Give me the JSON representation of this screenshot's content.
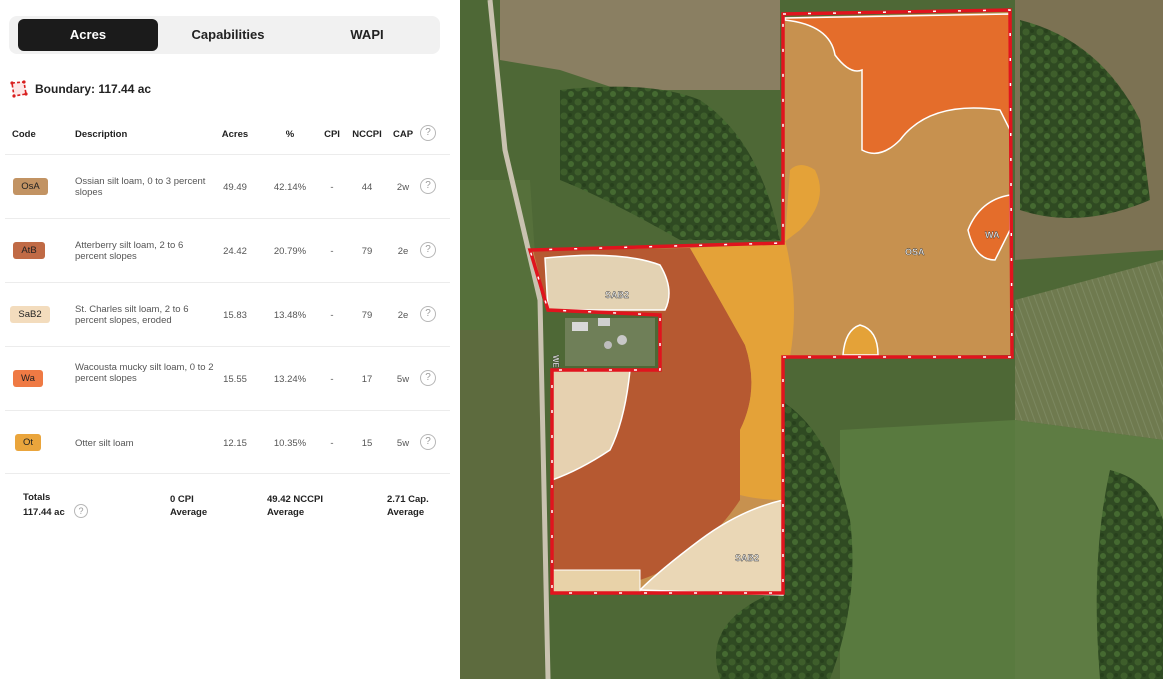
{
  "tabs": [
    {
      "label": "Acres",
      "active": true
    },
    {
      "label": "Capabilities",
      "active": false
    },
    {
      "label": "WAPI",
      "active": false
    }
  ],
  "boundary": {
    "label": "Boundary: 117.44 ac",
    "icon": "boundary-polygon-icon"
  },
  "table": {
    "headers": {
      "code": "Code",
      "description": "Description",
      "acres": "Acres",
      "percent": "%",
      "cpi": "CPI",
      "nccpi": "NCCPI",
      "cap": "CAP"
    },
    "rows": [
      {
        "code": "OsA",
        "color": "#c29363",
        "description": "Ossian silt loam, 0 to 3 percent slopes",
        "acres": "49.49",
        "percent": "42.14%",
        "cpi": "-",
        "nccpi": "44",
        "cap": "2w"
      },
      {
        "code": "AtB",
        "color": "#c06a45",
        "description": "Atterberry silt loam, 2 to 6 percent slopes",
        "acres": "24.42",
        "percent": "20.79%",
        "cpi": "-",
        "nccpi": "79",
        "cap": "2e"
      },
      {
        "code": "SaB2",
        "color": "#f3dcbd",
        "description": "St. Charles silt loam, 2 to 6 percent slopes, eroded",
        "acres": "15.83",
        "percent": "13.48%",
        "cpi": "-",
        "nccpi": "79",
        "cap": "2e"
      },
      {
        "code": "Wa",
        "color": "#ef7a44",
        "description": "Wacousta mucky silt loam, 0 to 2 percent slopes",
        "acres": "15.55",
        "percent": "13.24%",
        "cpi": "-",
        "nccpi": "17",
        "cap": "5w"
      },
      {
        "code": "Ot",
        "color": "#eaa53c",
        "description": "Otter silt loam",
        "acres": "12.15",
        "percent": "10.35%",
        "cpi": "-",
        "nccpi": "15",
        "cap": "5w"
      }
    ]
  },
  "totals": {
    "title": "Totals",
    "acres": "117.44 ac",
    "cpi_value": "0 CPI",
    "cpi_label": "Average",
    "nccpi_value": "49.42 NCCPI",
    "nccpi_label": "Average",
    "cap_value": "2.71 Cap.",
    "cap_label": "Average"
  },
  "map": {
    "labels": {
      "osa": "OSA",
      "wa": "WA",
      "sab2_top": "SAB2",
      "sab2_bottom": "SAB2",
      "road": "WENDT RD"
    },
    "colors": {
      "boundary": "#e0141e",
      "osa": "#c7914f",
      "wa": "#e46d2b",
      "atb": "#b5562f",
      "sab2": "#f1dcbc",
      "ot": "#e4a238",
      "satellite": "#3d5a2c"
    }
  }
}
